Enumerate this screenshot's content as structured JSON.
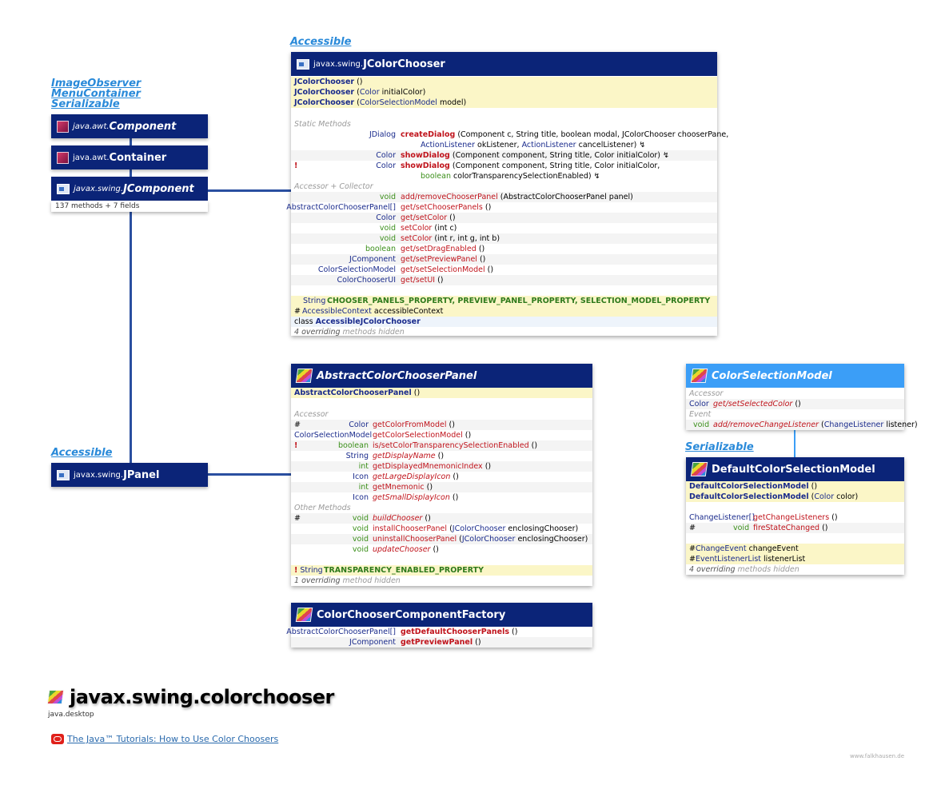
{
  "left_chain": {
    "interfaces": [
      "ImageObserver",
      "MenuContainer",
      "Serializable"
    ],
    "component": {
      "pkg": "java.awt.",
      "name": "Component"
    },
    "container": {
      "pkg": "java.awt.",
      "name": "Container"
    },
    "jcomponent": {
      "pkg": "javax.swing.",
      "name": "JComponent",
      "info": "137 methods + 7 fields"
    },
    "jpanel_iface": "Accessible",
    "jpanel": {
      "pkg": "javax.swing.",
      "name": "JPanel"
    }
  },
  "jcolorchooser": {
    "iface": "Accessible",
    "pkg": "javax.swing.",
    "name": "JColorChooser",
    "ctors": [
      [
        "JColorChooser",
        " ()"
      ],
      [
        "JColorChooser",
        " (",
        "Color",
        " initialColor)"
      ],
      [
        "JColorChooser",
        " (",
        "ColorSelectionModel",
        " model)"
      ]
    ],
    "static_label": "Static Methods",
    "static": {
      "m1_type": "JDialog",
      "m1_name": "createDialog",
      "m1_args": "(Component c, String title, boolean modal, JColorChooser chooserPane,",
      "m1_args2_t1": "ActionListener",
      "m1_args2_a1": " okListener, ",
      "m1_args2_t2": "ActionListener",
      "m1_args2_a2": " cancelListener) ↯",
      "m2_type": "Color",
      "m2_name": "showDialog",
      "m2_args": "(Component component, String title, Color initialColor) ↯",
      "m3_flag": "!",
      "m3_type": "Color",
      "m3_name": "showDialog",
      "m3_args": "(Component component, String title, Color initialColor,",
      "m3_args2_t": "boolean",
      "m3_args2_a": " colorTransparencySelectionEnabled) ↯"
    },
    "acc_label": "Accessor + Collector",
    "acc": [
      {
        "t": "void",
        "n": "add/removeChooserPanel",
        "a": " (AbstractColorChooserPanel panel)"
      },
      {
        "t": "AbstractColorChooserPanel[]",
        "n": "get/setChooserPanels",
        "a": " ()"
      },
      {
        "t": "Color",
        "n": "get/setColor",
        "a": " ()"
      },
      {
        "t": "void",
        "n": "setColor",
        "a": " (int c)"
      },
      {
        "t": "void",
        "n": "setColor",
        "a": " (int r, int g, int b)"
      },
      {
        "t": "boolean",
        "n": "get/setDragEnabled",
        "a": " ()"
      },
      {
        "t": "JComponent",
        "n": "get/setPreviewPanel",
        "a": " ()"
      },
      {
        "t": "ColorSelectionModel",
        "n": "get/setSelectionModel",
        "a": " ()"
      },
      {
        "t": "ColorChooserUI",
        "n": "get/setUI",
        "a": " ()"
      }
    ],
    "field_type": "String",
    "field_names": "CHOOSER_PANELS_PROPERTY, PREVIEW_PANEL_PROPERTY, SELECTION_MODEL_PROPERTY",
    "prot_mark": "#",
    "prot_type": "AccessibleContext",
    "prot_name": " accessibleContext",
    "inner_kw": "class ",
    "inner_name": "AccessibleJColorChooser",
    "hidden_a": "4 overriding",
    "hidden_b": " methods hidden"
  },
  "abstract_panel": {
    "name": "AbstractColorChooserPanel",
    "ctor_name": "AbstractColorChooserPanel",
    "ctor_args": " ()",
    "acc_label": "Accessor",
    "acc": [
      {
        "f": "#",
        "t": "Color",
        "n": "getColorFromModel",
        "a": " ()"
      },
      {
        "f": "",
        "t": "ColorSelectionModel",
        "n": "getColorSelectionModel",
        "a": " ()"
      },
      {
        "f": "!",
        "t": "boolean",
        "n": "is/setColorTransparencySelectionEnabled",
        "a": " ()"
      },
      {
        "f": "",
        "t": "String",
        "n": "getDisplayName",
        "a": " ()"
      },
      {
        "f": "",
        "t": "int",
        "n": "getDisplayedMnemonicIndex",
        "a": " ()"
      },
      {
        "f": "",
        "t": "Icon",
        "n": "getLargeDisplayIcon",
        "a": " ()"
      },
      {
        "f": "",
        "t": "int",
        "n": "getMnemonic",
        "a": " ()"
      },
      {
        "f": "",
        "t": "Icon",
        "n": "getSmallDisplayIcon",
        "a": " ()"
      }
    ],
    "other_label": "Other Methods",
    "other": [
      {
        "f": "#",
        "t": "void",
        "n": "buildChooser",
        "a": " ()"
      },
      {
        "f": "",
        "t": "void",
        "n": "installChooserPanel",
        "a1": " (",
        "at": "JColorChooser",
        "a2": " enclosingChooser)"
      },
      {
        "f": "",
        "t": "void",
        "n": "uninstallChooserPanel",
        "a1": " (",
        "at": "JColorChooser",
        "a2": " enclosingChooser)"
      },
      {
        "f": "",
        "t": "void",
        "n": "updateChooser",
        "a": " ()"
      }
    ],
    "field_flag": "!",
    "field_type": " String",
    "field_name": "TRANSPARENCY_ENABLED_PROPERTY",
    "hidden_a": "1 overriding",
    "hidden_b": " method hidden"
  },
  "factory": {
    "name": "ColorChooserComponentFactory",
    "rows": [
      {
        "t": "AbstractColorChooserPanel[]",
        "n": "getDefaultChooserPanels",
        "a": " ()"
      },
      {
        "t": "JComponent",
        "n": "getPreviewPanel",
        "a": " ()"
      }
    ]
  },
  "csm": {
    "name": "ColorSelectionModel",
    "acc_label": "Accessor",
    "acc_t": "Color",
    "acc_n": "get/setSelectedColor",
    "acc_a": " ()",
    "ev_label": "Event",
    "ev_t": "void",
    "ev_n": "add/removeChangeListener",
    "ev_a1": " (",
    "ev_at": "ChangeListener",
    "ev_a2": " listener)"
  },
  "dcsm": {
    "iface": "Serializable",
    "name": "DefaultColorSelectionModel",
    "c1_n": "DefaultColorSelectionModel",
    "c1_a": " ()",
    "c2_n": "DefaultColorSelectionModel",
    "c2_a1": " (",
    "c2_at": "Color",
    "c2_a2": " color)",
    "m1_t": "ChangeListener[]",
    "m1_n": "getChangeListeners",
    "m1_a": " ()",
    "m2_f": "#",
    "m2_t": "void",
    "m2_n": "fireStateChanged",
    "m2_a": " ()",
    "f1_f": "#",
    "f1_t": "ChangeEvent",
    "f1_n": " changeEvent",
    "f2_f": "#",
    "f2_t": "EventListenerList",
    "f2_n": " listenerList",
    "hidden_a": "4 overriding",
    "hidden_b": " methods hidden"
  },
  "package": {
    "name": "javax.swing.colorchooser",
    "module": "java.desktop",
    "tutorial": "The Java™ Tutorials: How to Use Color Choosers",
    "credit": "www.falkhausen.de"
  },
  "colors": {
    "header": "#0b2478",
    "header_light": "#3b9ef7",
    "iface": "#2a8ad9",
    "ctor_bg": "#fbf6c7"
  }
}
